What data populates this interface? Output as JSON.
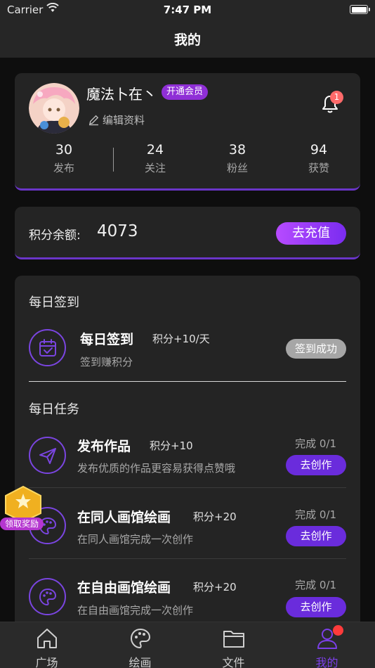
{
  "status_bar": {
    "carrier": "Carrier",
    "time": "7:47 PM"
  },
  "nav": {
    "title": "我的"
  },
  "profile": {
    "username": "魔法卜在丶",
    "vip_label": "开通会员",
    "edit_label": "编辑资料",
    "notification_count": "1",
    "stats": [
      {
        "value": "30",
        "label": "发布"
      },
      {
        "value": "24",
        "label": "关注"
      },
      {
        "value": "38",
        "label": "粉丝"
      },
      {
        "value": "94",
        "label": "获赞"
      }
    ]
  },
  "points": {
    "label": "积分余额:",
    "value": "4073",
    "recharge_label": "去充值"
  },
  "daily_signin": {
    "section_title": "每日签到",
    "title": "每日签到",
    "points": "积分+10/天",
    "desc": "签到赚积分",
    "status_label": "签到成功"
  },
  "daily_tasks": {
    "section_title": "每日任务",
    "items": [
      {
        "title": "发布作品",
        "points": "积分+10",
        "desc": "发布优质的作品更容易获得点赞哦",
        "progress": "完成 0/1",
        "button": "去创作",
        "icon": "paper-plane-icon"
      },
      {
        "title": "在同人画馆绘画",
        "points": "积分+20",
        "desc": "在同人画馆完成一次创作",
        "progress": "完成 0/1",
        "button": "去创作",
        "icon": "palette-icon"
      },
      {
        "title": "在自由画馆绘画",
        "points": "积分+20",
        "desc": "在自由画馆完成一次创作",
        "progress": "完成 0/1",
        "button": "去创作",
        "icon": "palette-icon"
      }
    ]
  },
  "reward_float": {
    "label": "领取奖励"
  },
  "tabs": [
    {
      "label": "广场",
      "icon": "home-icon"
    },
    {
      "label": "绘画",
      "icon": "palette-icon"
    },
    {
      "label": "文件",
      "icon": "folder-icon"
    },
    {
      "label": "我的",
      "icon": "user-icon",
      "active": true
    }
  ],
  "colors": {
    "accent": "#7a45e0",
    "button": "#6a2cdc",
    "badge": "#ff6a6a",
    "background": "#0e0e0e",
    "card": "#242424"
  }
}
